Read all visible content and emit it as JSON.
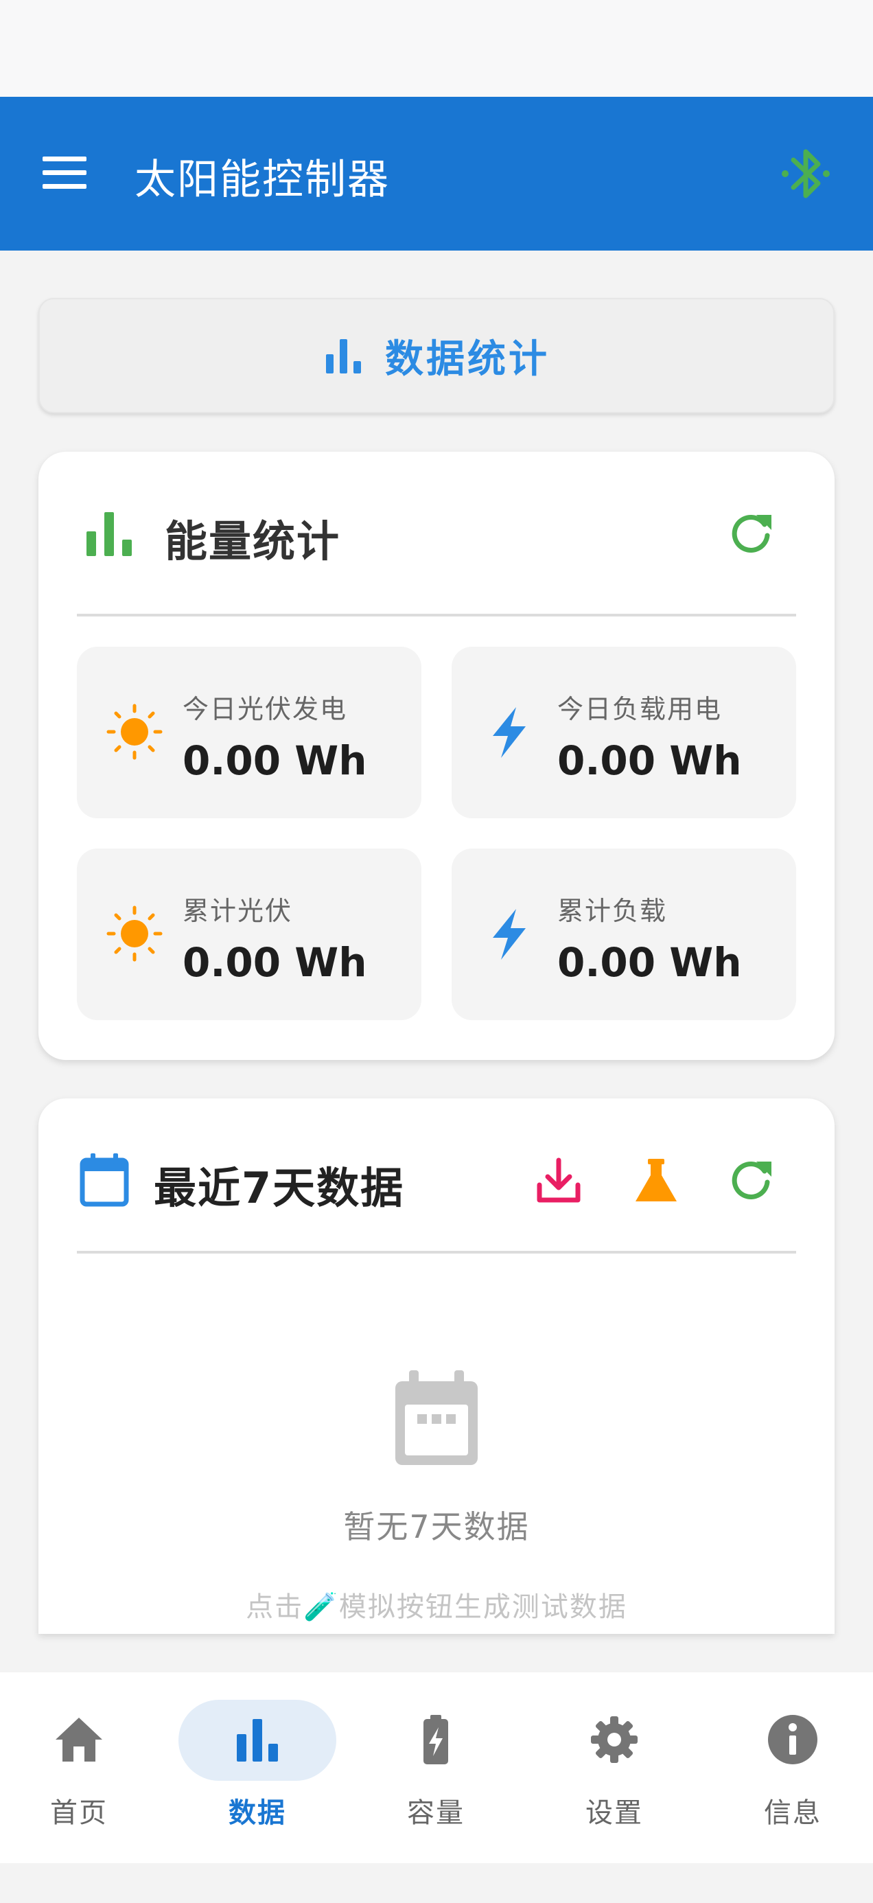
{
  "app": {
    "title": "太阳能控制器"
  },
  "section_header": {
    "label": "数据统计"
  },
  "energy": {
    "title": "能量统计",
    "stats": [
      {
        "caption": "今日光伏发电",
        "value": "0.00 Wh",
        "icon": "sun-icon"
      },
      {
        "caption": "今日负载用电",
        "value": "0.00 Wh",
        "icon": "bolt-icon"
      },
      {
        "caption": "累计光伏",
        "value": "0.00 Wh",
        "icon": "sun-icon"
      },
      {
        "caption": "累计负载",
        "value": "0.00 Wh",
        "icon": "bolt-icon"
      }
    ]
  },
  "week": {
    "title": "最近7天数据",
    "empty_title": "暂无7天数据",
    "empty_hint": "点击🧪模拟按钮生成测试数据"
  },
  "nav": {
    "items": [
      {
        "label": "首页",
        "icon": "home-icon",
        "active": false
      },
      {
        "label": "数据",
        "icon": "bar-chart-icon",
        "active": true
      },
      {
        "label": "容量",
        "icon": "battery-charging-icon",
        "active": false
      },
      {
        "label": "设置",
        "icon": "gear-icon",
        "active": false
      },
      {
        "label": "信息",
        "icon": "info-icon",
        "active": false
      }
    ]
  },
  "colors": {
    "primary": "#1976d2",
    "accent_blue": "#2c8be3",
    "green": "#4caf50",
    "orange": "#ff9800",
    "pink": "#e91e63",
    "bluetooth": "#4caf50"
  }
}
